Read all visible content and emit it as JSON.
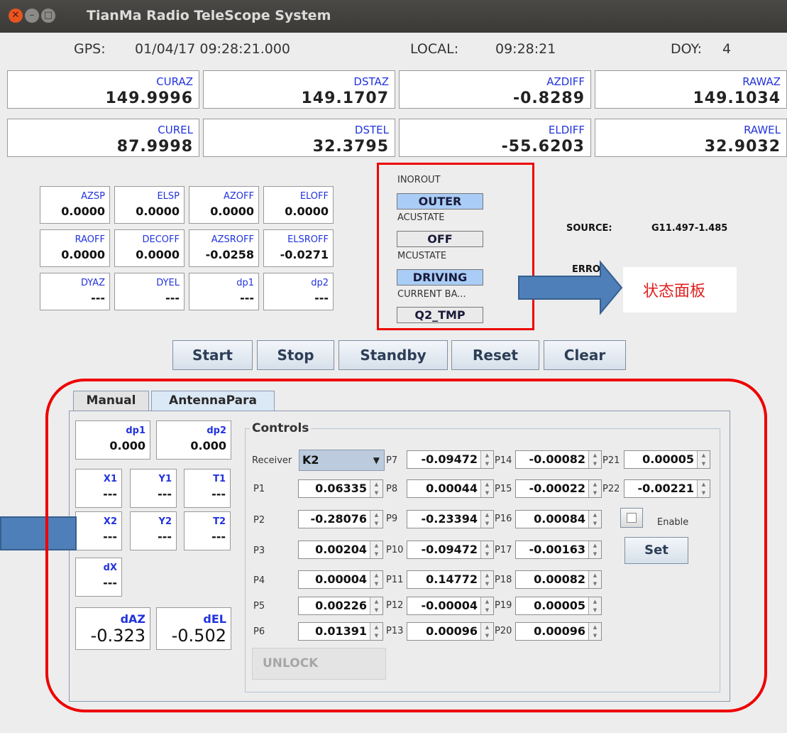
{
  "window": {
    "title": "TianMa Radio TeleScope System"
  },
  "header": {
    "gps_label": "GPS:",
    "gps_value": "01/04/17 09:28:21.000",
    "local_label": "LOCAL:",
    "local_value": "09:28:21",
    "doy_label": "DOY:",
    "doy_value": "4"
  },
  "big_boxes": [
    {
      "label": "CURAZ",
      "value": "149.9996"
    },
    {
      "label": "DSTAZ",
      "value": "149.1707"
    },
    {
      "label": "AZDIFF",
      "value": "-0.8289"
    },
    {
      "label": "RAWAZ",
      "value": "149.1034"
    },
    {
      "label": "CUREL",
      "value": "87.9998"
    },
    {
      "label": "DSTEL",
      "value": "32.3795"
    },
    {
      "label": "ELDIFF",
      "value": "-55.6203"
    },
    {
      "label": "RAWEL",
      "value": "32.9032"
    }
  ],
  "small_boxes": [
    {
      "label": "AZSP",
      "value": "0.0000"
    },
    {
      "label": "ELSP",
      "value": "0.0000"
    },
    {
      "label": "AZOFF",
      "value": "0.0000"
    },
    {
      "label": "ELOFF",
      "value": "0.0000"
    },
    {
      "label": "RAOFF",
      "value": "0.0000"
    },
    {
      "label": "DECOFF",
      "value": "0.0000"
    },
    {
      "label": "AZSROFF",
      "value": "-0.0258"
    },
    {
      "label": "ELSROFF",
      "value": "-0.0271"
    },
    {
      "label": "DYAZ",
      "value": "---"
    },
    {
      "label": "DYEL",
      "value": "---"
    },
    {
      "label": "dp1",
      "value": "---"
    },
    {
      "label": "dp2",
      "value": "---"
    }
  ],
  "status_panel": {
    "inorout_label": "INOROUT",
    "inorout_value": "OUTER",
    "acustate_label": "ACUSTATE",
    "acustate_value": "OFF",
    "mcustate_label": "MCUSTATE",
    "mcustate_value": "DRIVING",
    "current_band_label": "CURRENT BA...",
    "current_band_value": "Q2_TMP"
  },
  "source": {
    "label": "SOURCE:",
    "value": "G11.497-1.485"
  },
  "error": {
    "label": "ERRO"
  },
  "annotation": {
    "status_panel_callout": "状态面板"
  },
  "actions": {
    "start": "Start",
    "stop": "Stop",
    "standby": "Standby",
    "reset": "Reset",
    "clear": "Clear"
  },
  "tabs": {
    "manual": "Manual",
    "antennapara": "AntennaPara"
  },
  "left_panel": {
    "dp1": {
      "label": "dp1",
      "value": "0.000"
    },
    "dp2": {
      "label": "dp2",
      "value": "0.000"
    },
    "x1": {
      "label": "X1",
      "value": "---"
    },
    "y1": {
      "label": "Y1",
      "value": "---"
    },
    "t1": {
      "label": "T1",
      "value": "---"
    },
    "x2": {
      "label": "X2",
      "value": "---"
    },
    "y2": {
      "label": "Y2",
      "value": "---"
    },
    "t2": {
      "label": "T2",
      "value": "---"
    },
    "dx": {
      "label": "dX",
      "value": "---"
    },
    "daz": {
      "label": "dAZ",
      "value": "-0.323"
    },
    "del": {
      "label": "dEL",
      "value": "-0.502"
    }
  },
  "controls": {
    "title": "Controls",
    "receiver_label": "Receiver",
    "receiver_value": "K2",
    "col1": [
      {
        "label": "P1",
        "value": "0.06335"
      },
      {
        "label": "P2",
        "value": "-0.28076"
      },
      {
        "label": "P3",
        "value": "0.00204"
      },
      {
        "label": "P4",
        "value": "0.00004"
      },
      {
        "label": "P5",
        "value": "0.00226"
      },
      {
        "label": "P6",
        "value": "0.01391"
      }
    ],
    "col2": [
      {
        "label": "P7",
        "value": "-0.09472"
      },
      {
        "label": "P8",
        "value": "0.00044"
      },
      {
        "label": "P9",
        "value": "-0.23394"
      },
      {
        "label": "P10",
        "value": "-0.09472"
      },
      {
        "label": "P11",
        "value": "0.14772"
      },
      {
        "label": "P12",
        "value": "-0.00004"
      },
      {
        "label": "P13",
        "value": "0.00096"
      }
    ],
    "col3": [
      {
        "label": "P14",
        "value": "-0.00082"
      },
      {
        "label": "P15",
        "value": "-0.00022"
      },
      {
        "label": "P16",
        "value": "0.00084"
      },
      {
        "label": "P17",
        "value": "-0.00163"
      },
      {
        "label": "P18",
        "value": "0.00082"
      },
      {
        "label": "P19",
        "value": "0.00005"
      },
      {
        "label": "P20",
        "value": "0.00096"
      }
    ],
    "col4": [
      {
        "label": "P21",
        "value": "0.00005"
      },
      {
        "label": "P22",
        "value": "-0.00221"
      }
    ],
    "enable_label": "Enable",
    "set_label": "Set",
    "unlock_label": "UNLOCK"
  },
  "colors": {
    "highlight_red": "#ee0000",
    "arrow_blue": "#4f7fb8",
    "state_on": "#a9cdf6"
  }
}
